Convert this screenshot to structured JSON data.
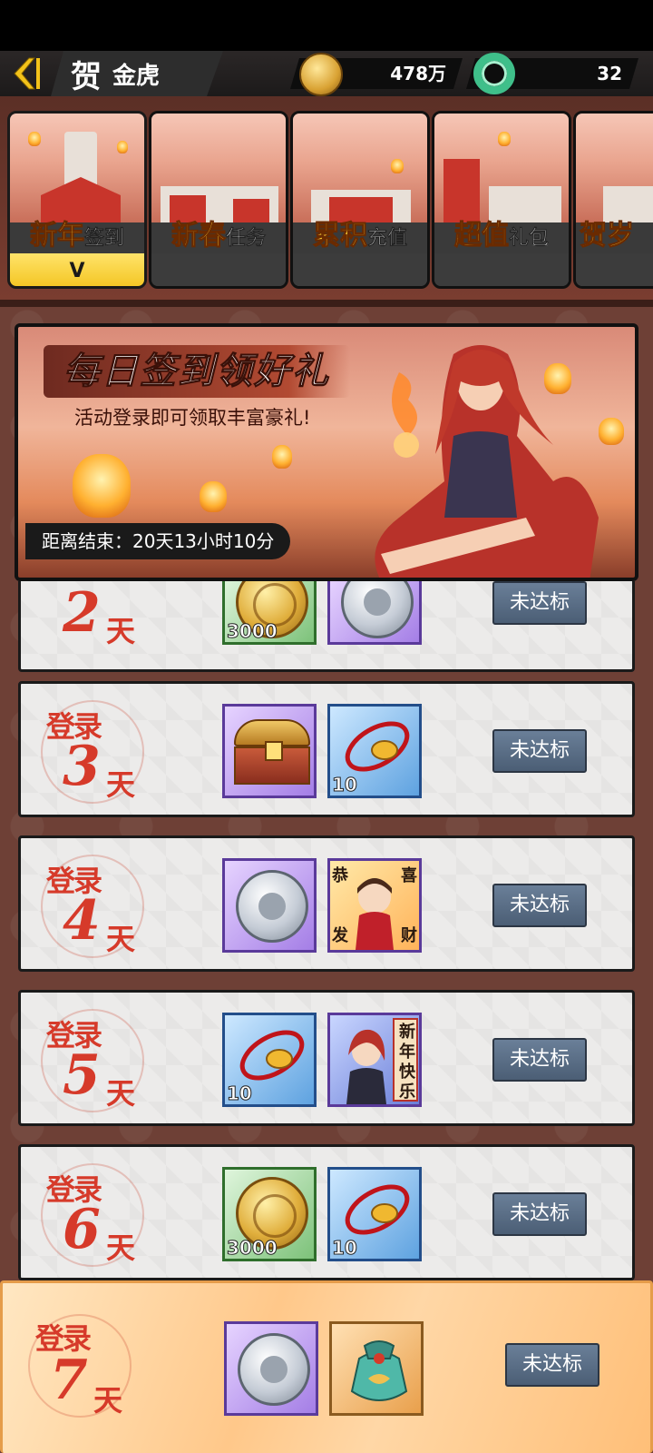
{
  "header": {
    "title_prefix": "贺",
    "title": "金虎",
    "gold_amount": "478万",
    "jade_amount": "32"
  },
  "tabs": [
    {
      "big": "新年",
      "small": "签到",
      "active": true,
      "indicator": "V"
    },
    {
      "big": "新春",
      "small": "任务",
      "active": false
    },
    {
      "big": "累积",
      "small": "充值",
      "active": false
    },
    {
      "big": "超值",
      "small": "礼包",
      "active": false
    },
    {
      "big": "贺岁",
      "small": "",
      "active": false
    }
  ],
  "banner": {
    "title": "每日签到领好礼",
    "subtitle": "活动登录即可领取丰富豪礼!",
    "countdown": "距离结束：20天13小时10分"
  },
  "login_label": "登录",
  "day_unit": "天",
  "rows": [
    {
      "day": "2",
      "items": [
        {
          "kind": "gold-coin",
          "qty": "3000"
        },
        {
          "kind": "silver-coin",
          "qty": ""
        }
      ],
      "button": "未达标"
    },
    {
      "day": "3",
      "items": [
        {
          "kind": "treasure-chest",
          "qty": ""
        },
        {
          "kind": "red-bracelet",
          "qty": "10"
        }
      ],
      "button": "未达标"
    },
    {
      "day": "4",
      "items": [
        {
          "kind": "silver-coin",
          "qty": ""
        },
        {
          "kind": "avatar-frame",
          "qty": "",
          "chars": [
            "恭",
            "喜",
            "发",
            "财"
          ]
        }
      ],
      "button": "未达标"
    },
    {
      "day": "5",
      "items": [
        {
          "kind": "red-bracelet",
          "qty": "10"
        },
        {
          "kind": "avatar-frame",
          "qty": "",
          "chars": [
            "新",
            "年",
            "快",
            "乐"
          ]
        }
      ],
      "button": "未达标"
    },
    {
      "day": "6",
      "items": [
        {
          "kind": "gold-coin",
          "qty": "3000"
        },
        {
          "kind": "red-bracelet",
          "qty": "10"
        }
      ],
      "button": "未达标"
    },
    {
      "day": "7",
      "items": [
        {
          "kind": "silver-coin",
          "qty": ""
        },
        {
          "kind": "lucky-bag",
          "qty": ""
        }
      ],
      "button": "未达标"
    }
  ],
  "colors": {
    "accent_yellow": "#ffd43a",
    "seal_red": "#d63a2a",
    "button_slate": "#5a6e86",
    "content_bg": "#6e4036"
  }
}
